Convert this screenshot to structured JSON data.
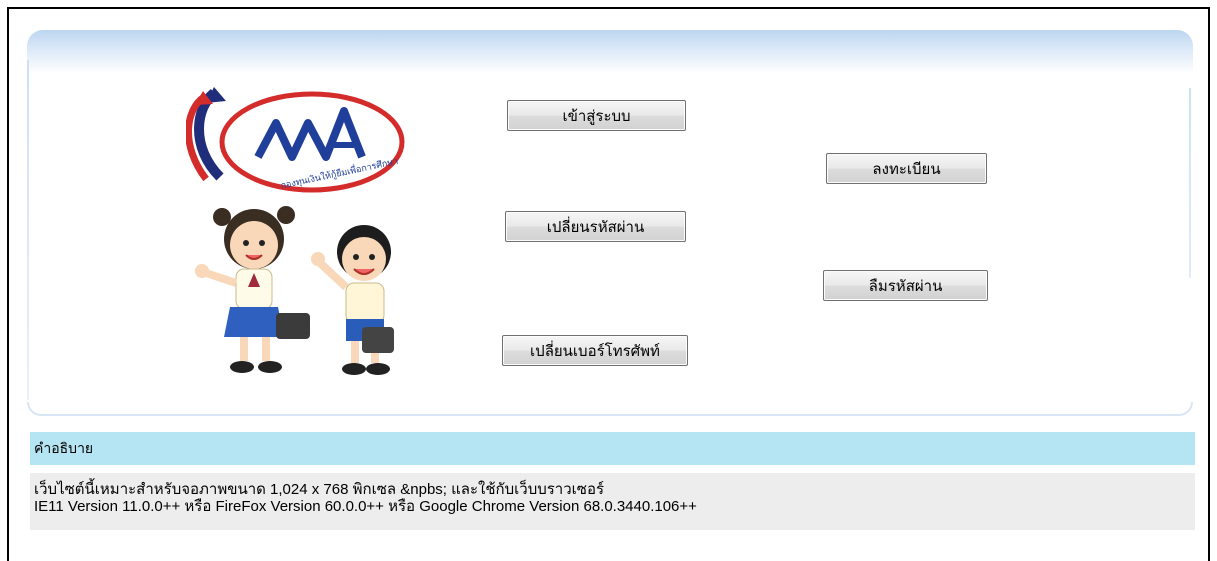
{
  "buttons": {
    "login": "เข้าสู่ระบบ",
    "register": "ลงทะเบียน",
    "change_password": "เปลี่ยนรหัสผ่าน",
    "forgot_password": "ลืมรหัสผ่าน",
    "change_phone": "เปลี่ยนเบอร์โทรศัพท์"
  },
  "logo": {
    "text": "กองทุนเงินให้กู้ยืมเพื่อการศึกษา",
    "colors": {
      "red": "#d42b2b",
      "blue": "#1f3f9a",
      "arrow_navy": "#1f2d7a"
    }
  },
  "description": {
    "heading": "คำอธิบาย",
    "line1": "เว็บไซต์นี้เหมาะสำหรับจอภาพขนาด 1,024 x 768 พิกเซล &npbs; และใช้กับเว็บบราวเซอร์",
    "line2": "IE11 Version 11.0.0++ หรือ FireFox Version 60.0.0++ หรือ Google Chrome Version 68.0.3440.106++"
  },
  "colors": {
    "description_header_bg": "#b5e5f2",
    "description_body_bg": "#ededed",
    "panel_gradient": "#bcd5f0"
  }
}
